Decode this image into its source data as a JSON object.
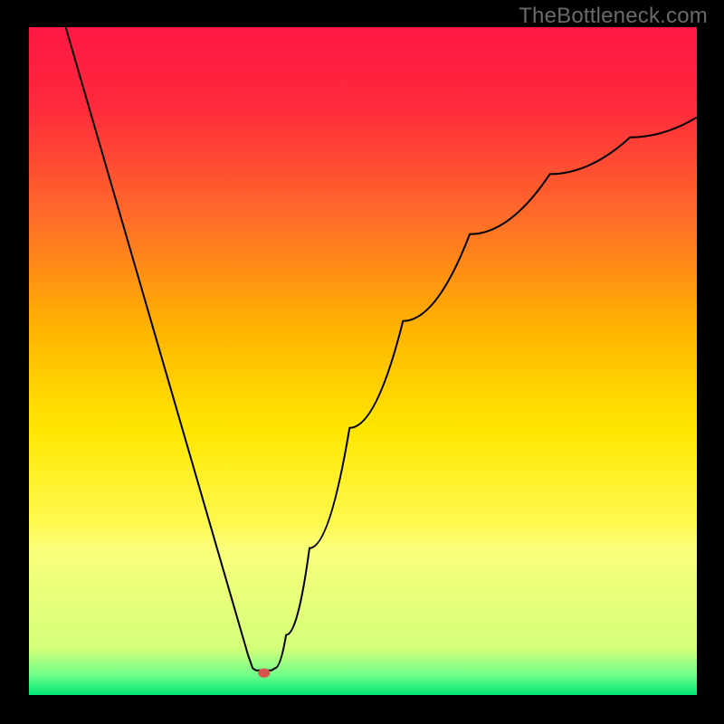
{
  "watermark": "TheBottleneck.com",
  "chart_data": {
    "type": "line",
    "title": "",
    "xlabel": "",
    "ylabel": "",
    "xlim": [
      0,
      100
    ],
    "ylim": [
      0,
      100
    ],
    "gradient_stops": [
      {
        "offset": 0,
        "color": "#ff1744"
      },
      {
        "offset": 12,
        "color": "#ff2a3c"
      },
      {
        "offset": 28,
        "color": "#ff6a2a"
      },
      {
        "offset": 45,
        "color": "#ffb300"
      },
      {
        "offset": 60,
        "color": "#ffe600"
      },
      {
        "offset": 74,
        "color": "#fff94d"
      },
      {
        "offset": 78,
        "color": "#fbff7a"
      },
      {
        "offset": 93,
        "color": "#d4ff7a"
      },
      {
        "offset": 97,
        "color": "#6fff8a"
      },
      {
        "offset": 100,
        "color": "#00e676"
      }
    ],
    "series": [
      {
        "name": "curve",
        "points": [
          {
            "x": 5.5,
            "y": 100
          },
          {
            "x": 32.8,
            "y": 6
          },
          {
            "x": 33.5,
            "y": 4
          },
          {
            "x": 34.0,
            "y": 3.7
          },
          {
            "x": 36.3,
            "y": 3.7
          },
          {
            "x": 36.8,
            "y": 4
          },
          {
            "x": 38.5,
            "y": 9
          },
          {
            "x": 42,
            "y": 22
          },
          {
            "x": 48,
            "y": 40
          },
          {
            "x": 56,
            "y": 56
          },
          {
            "x": 66,
            "y": 69
          },
          {
            "x": 78,
            "y": 78
          },
          {
            "x": 90,
            "y": 83.5
          },
          {
            "x": 100,
            "y": 86.5
          }
        ]
      }
    ],
    "marker": {
      "x": 35.2,
      "y": 3.3,
      "color": "#d9534f"
    }
  }
}
